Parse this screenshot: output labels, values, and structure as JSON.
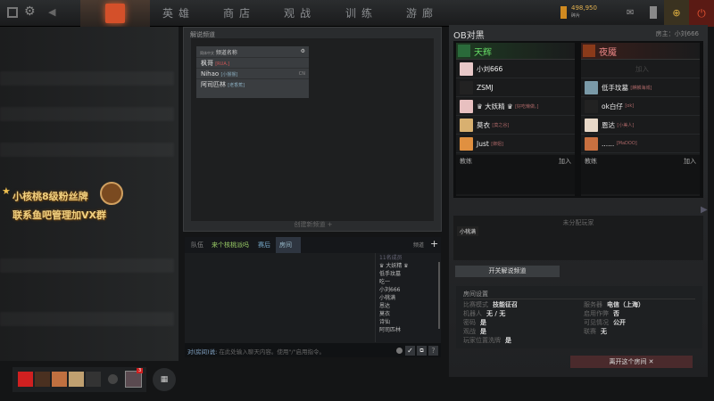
{
  "topbar": {
    "nav": [
      "英雄",
      "商店",
      "观战",
      "训练",
      "游廊"
    ],
    "shards": "498,950",
    "shards_label": "碎片"
  },
  "promo": {
    "line1": "小核桃8级粉丝牌",
    "line2": "联系鱼吧管理加VX群"
  },
  "channel": {
    "title": "解说频道",
    "header_lang": "简体中文",
    "header_name": "频道名称",
    "rows": [
      {
        "name": "枫哥",
        "tag": "[RUA.]"
      },
      {
        "name": "Nihao",
        "tag": "[小猴猴]",
        "lang": "CN"
      },
      {
        "name": "阿司匹林",
        "tag": "[老香蕉]"
      }
    ],
    "create": "创建新频道 +"
  },
  "chat": {
    "tabs": [
      "队伍",
      "来个核桃派吗",
      "赛后",
      "房间"
    ],
    "channels": "频道",
    "users_title": "11名成员",
    "users": [
      "♛ 大妖精 ♛",
      "低手玟墓",
      "吃一",
      "小刘666",
      "小桃满",
      "恩达",
      "莫衣",
      "诗仙",
      "阿司匹林"
    ],
    "prefix": "对(房间)说:",
    "placeholder": "在此处输入聊天内容。使用\"/\"启用指令。"
  },
  "lobby": {
    "title": "OB对黑",
    "host": "房主：小刘666",
    "radiant": {
      "name": "天辉",
      "players": [
        {
          "name": "小刘666",
          "tag": "",
          "color": "#e8c8c8"
        },
        {
          "name": "ZSMJ",
          "tag": "",
          "color": "#222"
        },
        {
          "name": "♛ 大妖精 ♛",
          "tag": "[好吃懒做。]",
          "color": "#e8c0c0"
        },
        {
          "name": "莫衣",
          "tag": "[莫之谷]",
          "color": "#d8b070"
        },
        {
          "name": "Just",
          "tag": "[御姐]",
          "color": "#e09040"
        }
      ]
    },
    "dire": {
      "name": "夜魇",
      "players": [
        {
          "name": "加入",
          "tag": "",
          "color": ""
        },
        {
          "name": "低手玟墓",
          "tag": "[麒麟海城]",
          "color": "#7a9aa8"
        },
        {
          "name": "ok白仔",
          "tag": "[ok]",
          "color": "#222"
        },
        {
          "name": "恩达",
          "tag": "[小美人]",
          "color": "#e8d8c8"
        },
        {
          "name": "......",
          "tag": "[MaDOO]",
          "color": "#c87040"
        }
      ]
    },
    "coach": "教练",
    "join": "加入",
    "unassigned": "未分配玩家",
    "unassigned_player": "小桃满",
    "toggle_btn": "开关解说频道",
    "settings_title": "房间设置",
    "settings_left": [
      [
        "比赛模式",
        "技能征召"
      ],
      [
        "机器人",
        "无 / 无"
      ],
      [
        "密码",
        "是"
      ],
      [
        "观战",
        "是"
      ],
      [
        "玩家位置洗牌",
        "是"
      ]
    ],
    "settings_right": [
      [
        "服务器",
        "电信（上海）"
      ],
      [
        "启用作弊",
        "否"
      ],
      [
        "可见情况",
        "公开"
      ],
      [
        "联赛",
        "无"
      ]
    ],
    "leave": "离开这个房间 ✕"
  },
  "dock": {
    "badge": "3"
  }
}
